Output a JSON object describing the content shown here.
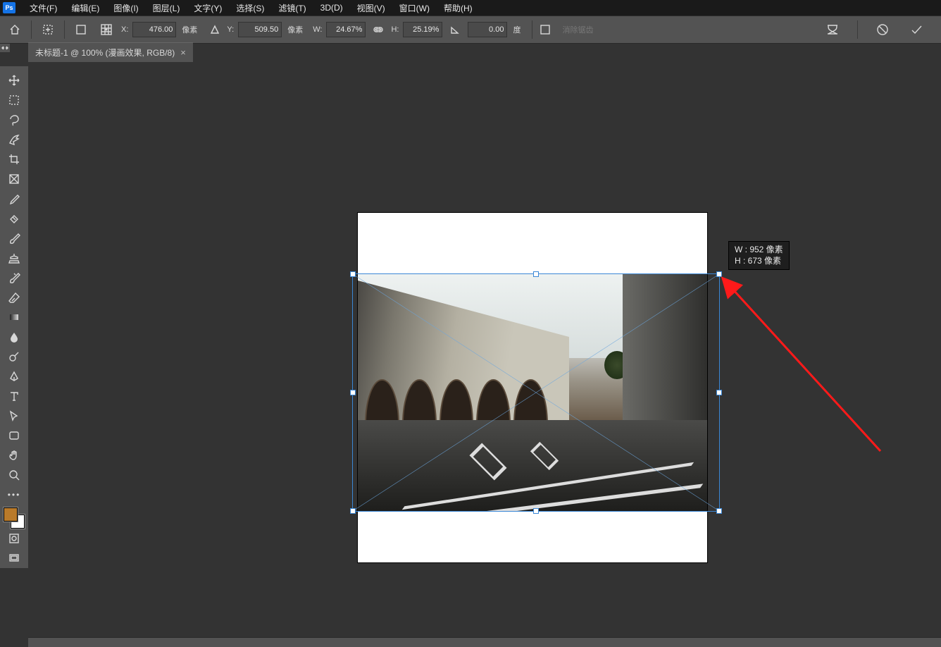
{
  "menubar": {
    "logo": "Ps",
    "items": [
      "文件(F)",
      "编辑(E)",
      "图像(I)",
      "图层(L)",
      "文字(Y)",
      "选择(S)",
      "滤镜(T)",
      "3D(D)",
      "视图(V)",
      "窗口(W)",
      "帮助(H)"
    ]
  },
  "optionsbar": {
    "x_label": "X:",
    "x_value": "476.00",
    "x_unit": "像素",
    "y_label": "Y:",
    "y_value": "509.50",
    "y_unit": "像素",
    "w_label": "W:",
    "w_value": "24.67%",
    "h_label": "H:",
    "h_value": "25.19%",
    "angle_value": "0.00",
    "angle_unit": "度",
    "clear_warning": "消除锯齿"
  },
  "document_tab": {
    "title": "未标题-1 @ 100% (漫画效果, RGB/8)",
    "close": "×"
  },
  "size_tooltip": {
    "w_line": "W : 952 像素",
    "h_line": "H : 673 像素"
  },
  "tools": [
    "move-tool",
    "marquee-tool",
    "lasso-tool",
    "quick-select-tool",
    "crop-tool",
    "frame-tool",
    "eyedropper-tool",
    "healing-brush-tool",
    "brush-tool",
    "clone-stamp-tool",
    "history-brush-tool",
    "eraser-tool",
    "gradient-tool",
    "blur-tool",
    "dodge-tool",
    "pen-tool",
    "type-tool",
    "path-select-tool",
    "rectangle-tool",
    "hand-tool",
    "zoom-tool"
  ],
  "colors": {
    "foreground": "#b97a2a",
    "background": "#ffffff"
  }
}
